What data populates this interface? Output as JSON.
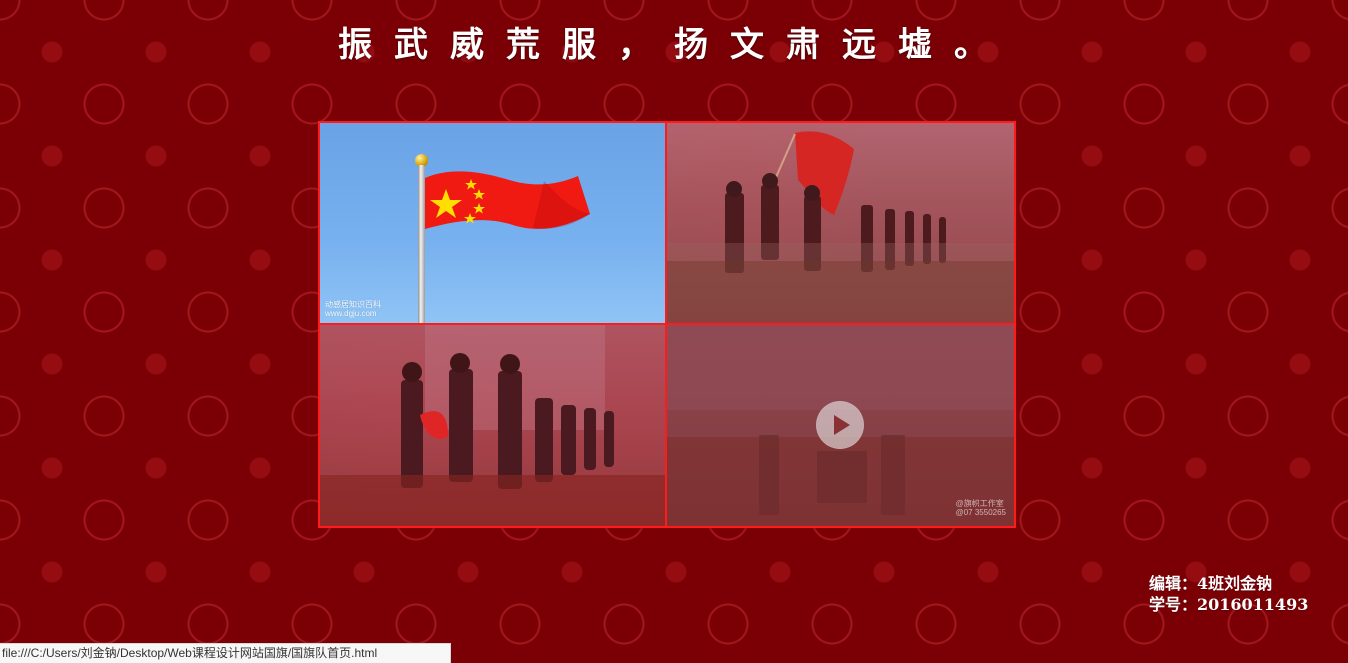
{
  "page": {
    "title": "振武威荒服，扬文肃远墟。"
  },
  "gallery": {
    "items": [
      {
        "watermark_line1": "动感居知识百科",
        "watermark_line2": "www.dgju.com"
      },
      {},
      {},
      {
        "watermark_line1": "@旗帜工作室",
        "watermark_line2": "@07 3550265"
      }
    ]
  },
  "credits": {
    "editor": "编辑：4班刘金钠",
    "student_id": "学号：2016011493"
  },
  "status_bar": {
    "url": "file:///C:/Users/刘金钠/Desktop/Web课程设计网站国旗/国旗队首页.html"
  },
  "colors": {
    "page_background": "#7a0006",
    "border_red": "#ff1b1b",
    "title_text": "#ffffff"
  },
  "icons": {
    "play": "play-icon"
  }
}
